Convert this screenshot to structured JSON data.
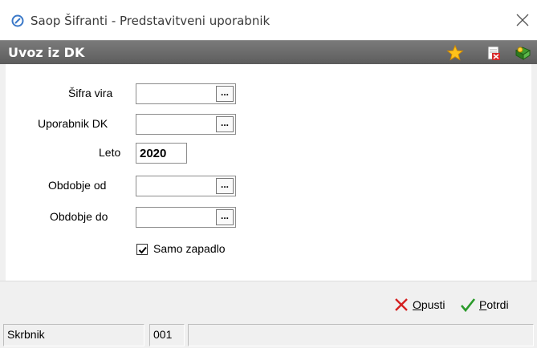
{
  "window": {
    "title": "Saop Šifranti - Predstavitveni uporabnik",
    "app_icon": "saop-logo-icon",
    "close_icon": "close-icon"
  },
  "header": {
    "title": "Uvoz iz DK",
    "icons": [
      "star-icon",
      "delete-document-icon",
      "help-book-icon"
    ]
  },
  "form": {
    "sifra_vira": {
      "label": "Šifra vira",
      "value": "",
      "button": "..."
    },
    "uporabnik_dk": {
      "label": "Uporabnik DK",
      "value": "",
      "button": "..."
    },
    "leto": {
      "label": "Leto",
      "value": "2020"
    },
    "obdobje_od": {
      "label": "Obdobje od",
      "value": "",
      "button": "..."
    },
    "obdobje_do": {
      "label": "Obdobje do",
      "value": "",
      "button": "..."
    },
    "samo_zapadlo": {
      "label": "Samo zapadlo",
      "checked": true
    }
  },
  "footer": {
    "cancel": {
      "label_first": "O",
      "label_rest": "pusti",
      "icon": "x-icon",
      "color": "#d42020"
    },
    "confirm": {
      "label_first": "P",
      "label_rest": "otrdi",
      "icon": "checkmark-icon",
      "color": "#2a9a2a"
    }
  },
  "status": {
    "user": "Skrbnik",
    "code": "001",
    "extra": ""
  }
}
